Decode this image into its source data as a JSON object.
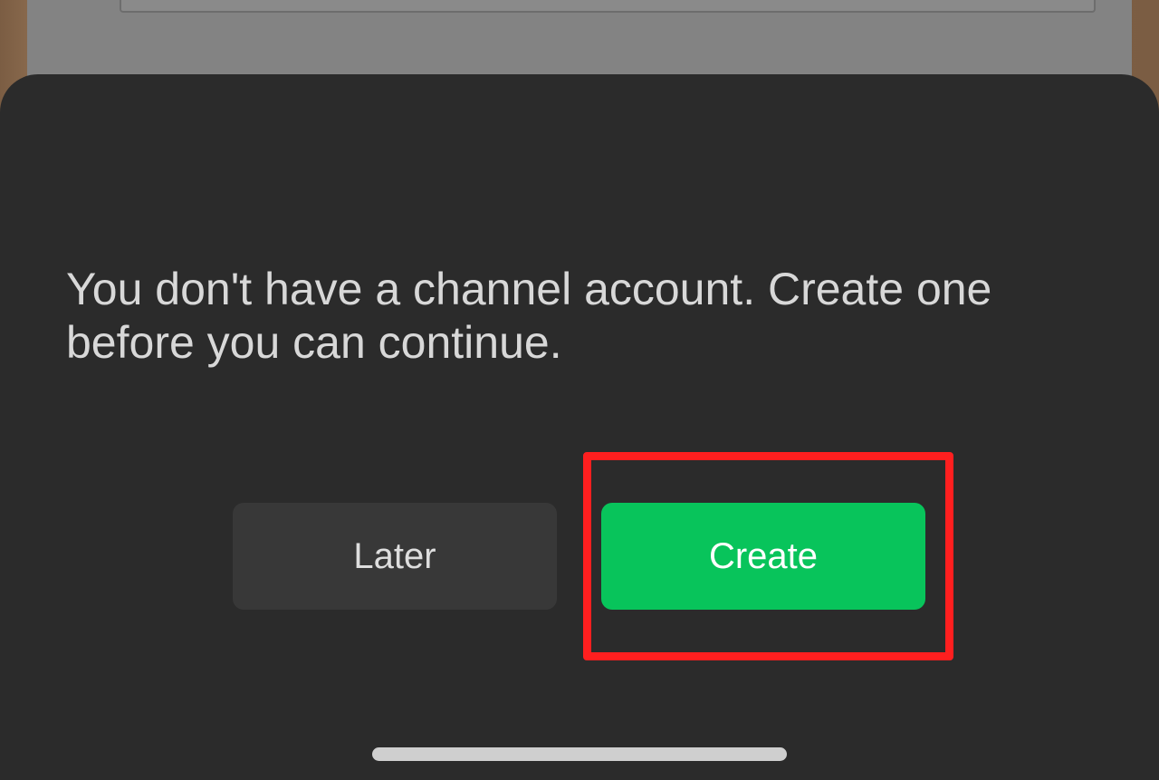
{
  "dialog": {
    "message": "You don't have a channel account. Create one before you can continue.",
    "buttons": {
      "later_label": "Later",
      "create_label": "Create"
    }
  },
  "colors": {
    "sheet_background": "#2b2b2b",
    "secondary_button": "#383838",
    "primary_button": "#08c45b",
    "highlight_outline": "#ff1f1f",
    "home_indicator": "#cfcfcf"
  }
}
